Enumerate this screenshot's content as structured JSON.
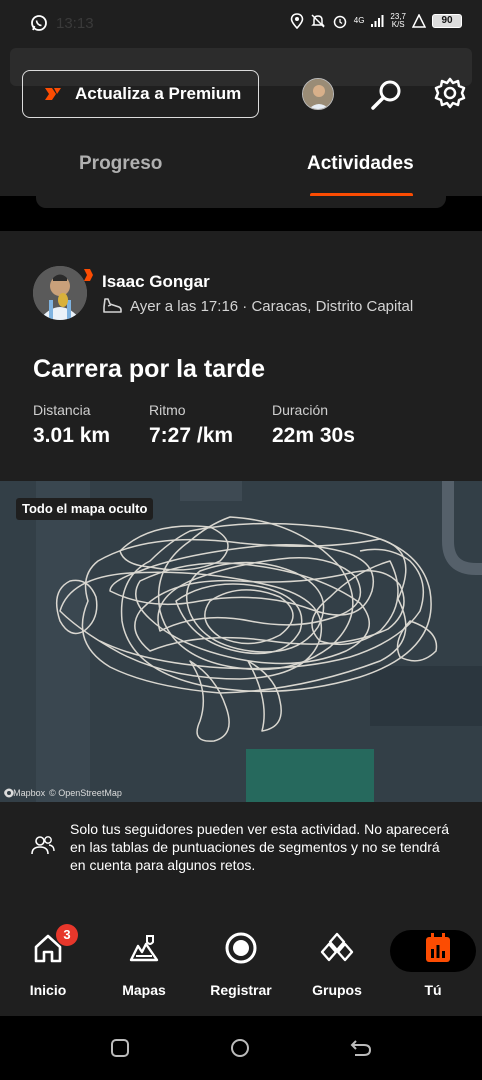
{
  "status_bar": {
    "time": "13:13",
    "network_speed": "23,7",
    "network_unit": "K/S",
    "network_type": "4G",
    "battery": "90"
  },
  "header": {
    "premium_label": "Actualiza a Premium",
    "tabs": [
      {
        "label": "Progreso"
      },
      {
        "label": "Actividades"
      }
    ],
    "active_tab": "Actividades",
    "accent_color": "#fc4c02"
  },
  "activity": {
    "athlete": "Isaac Gongar",
    "meta": "Ayer a las 17:16 · Caracas, Distrito Capital",
    "title": "Carrera por la tarde",
    "stats": [
      {
        "label": "Distancia",
        "value": "3.01 km"
      },
      {
        "label": "Ritmo",
        "value": "7:27 /km"
      },
      {
        "label": "Duración",
        "value": "22m 30s"
      }
    ]
  },
  "map": {
    "badge": "Todo el mapa oculto",
    "attribution": [
      "© Mapbox",
      "© OpenStreetMap"
    ]
  },
  "privacy": {
    "text": "Solo tus seguidores pueden ver esta actividad. No aparecerá en las tablas de puntuaciones de segmentos y no se tendrá en cuenta para algunos retos."
  },
  "bottom_nav": {
    "items": [
      {
        "label": "Inicio",
        "icon": "home-icon",
        "badge": "3"
      },
      {
        "label": "Mapas",
        "icon": "maps-icon"
      },
      {
        "label": "Registrar",
        "icon": "record-icon"
      },
      {
        "label": "Grupos",
        "icon": "groups-icon"
      },
      {
        "label": "Tú",
        "icon": "you-icon"
      }
    ],
    "active": "Tú"
  }
}
